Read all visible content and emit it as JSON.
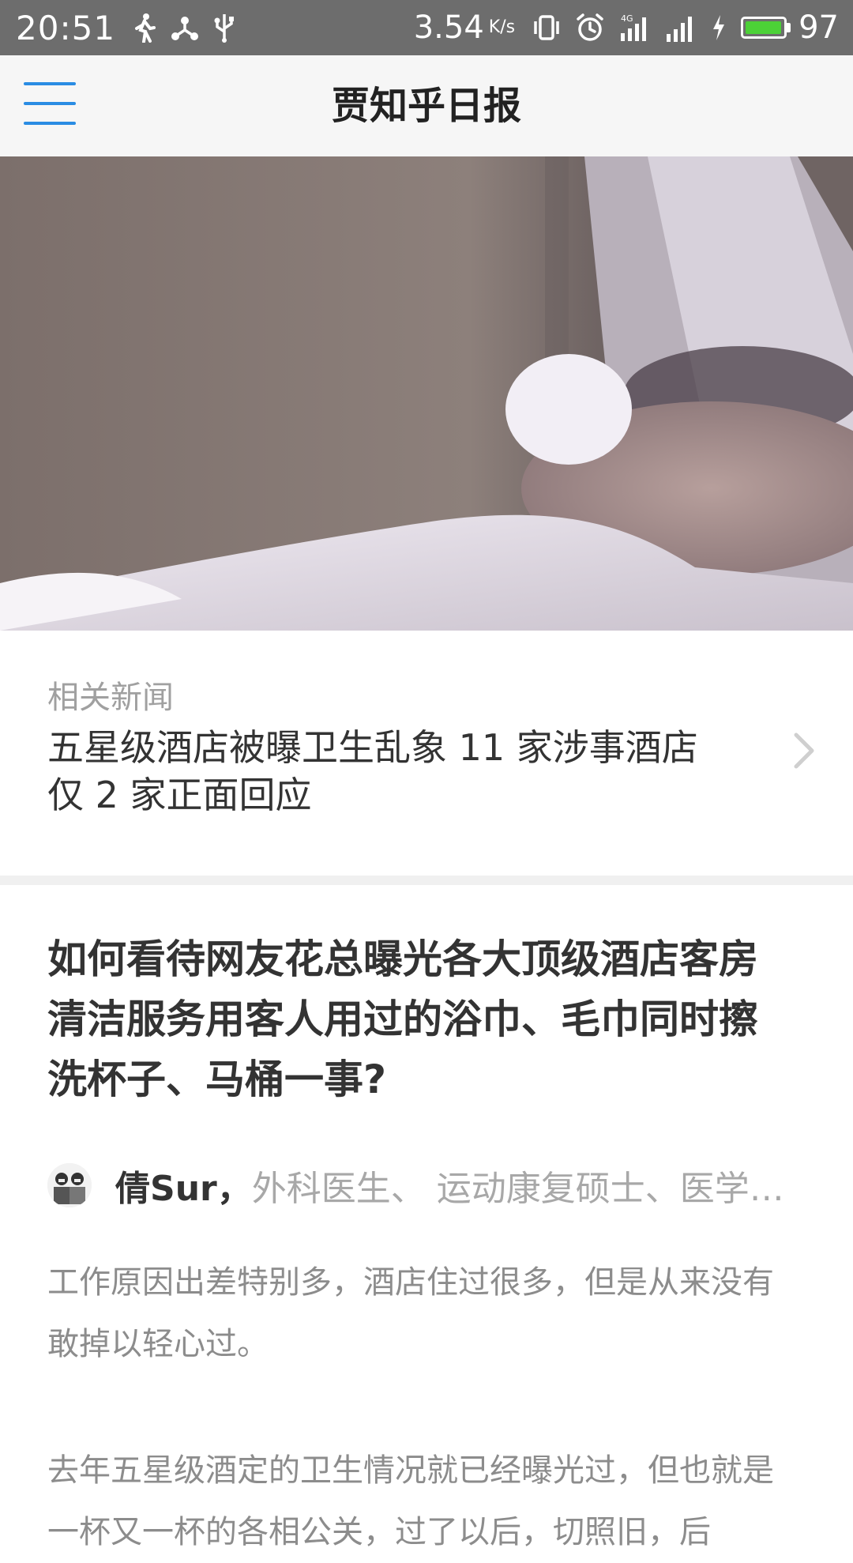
{
  "status_bar": {
    "time": "20:51",
    "speed": "3.54",
    "speed_unit": "K/s",
    "battery_level": 97,
    "battery_percent": "97",
    "icons": [
      "walk-icon",
      "share-icon",
      "usb-icon",
      "vibrate-icon",
      "alarm-icon",
      "signal-4g-icon",
      "signal-icon",
      "charging-icon",
      "battery-icon"
    ]
  },
  "header": {
    "title": "贾知乎日报",
    "menu_icon": "hamburger-menu-icon",
    "accent_color": "#2a8ce3"
  },
  "related": {
    "label": "相关新闻",
    "title": "五星级酒店被曝卫生乱象 11 家涉事酒店仅 2 家正面回应"
  },
  "article": {
    "question": "如何看待网友花总曝光各大顶级酒店客房清洁服务用客人用过的浴巾、毛巾同时擦洗杯子、马桶一事?",
    "author_name": "倩Sur，",
    "author_bio": "外科医生、 运动康复硕士、医学科普作者",
    "paragraph_1": "工作原因出差特别多，酒店住过很多，但是从来没有敢掉以轻心过。",
    "paragraph_2": "去年五星级酒定的卫生情况就已经曝光过，但也就是一杯又一杯的各相公关，过了以后，切照旧，后"
  }
}
